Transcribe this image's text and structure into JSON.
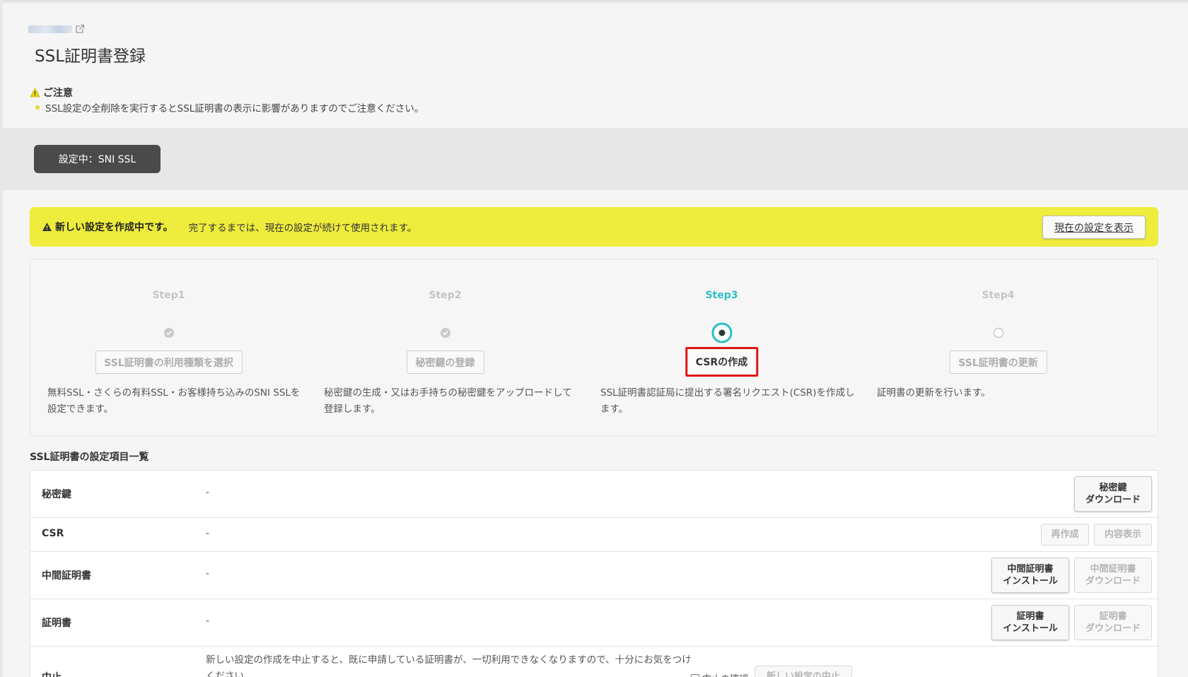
{
  "page": {
    "title": "SSL証明書登録",
    "notice_title": "ご注意",
    "notice_text": "SSL設定の全削除を実行するとSSL証明書の表示に影響がありますのでご注意ください。"
  },
  "status": {
    "current_setting": "設定中：SNI SSL"
  },
  "banner": {
    "warning": "新しい設定を作成中です。",
    "message": "完了するまでは、現在の設定が続けて使用されます。",
    "show_current": "現在の設定を表示"
  },
  "steps": [
    {
      "title": "Step1",
      "button": "SSL証明書の利用種類を選択",
      "desc": "無料SSL・さくらの有料SSL・お客様持ち込みのSNI SSLを設定できます。",
      "state": "done"
    },
    {
      "title": "Step2",
      "button": "秘密鍵の登録",
      "desc": "秘密鍵の生成・又はお手持ちの秘密鍵をアップロードして登録します。",
      "state": "done"
    },
    {
      "title": "Step3",
      "button": "CSRの作成",
      "desc": "SSL証明書認証局に提出する署名リクエスト(CSR)を作成します。",
      "state": "active"
    },
    {
      "title": "Step4",
      "button": "SSL証明書の更新",
      "desc": "証明書の更新を行います。",
      "state": "pending"
    }
  ],
  "settings": {
    "title": "SSL証明書の設定項目一覧",
    "rows": [
      {
        "label": "秘密鍵",
        "value": "-",
        "actions": [
          "秘密鍵\nダウンロード"
        ]
      },
      {
        "label": "CSR",
        "value": "-",
        "actions": [
          "再作成",
          "内容表示"
        ]
      },
      {
        "label": "中間証明書",
        "value": "-",
        "actions": [
          "中間証明書\nインストール",
          "中間証明書\nダウンロード"
        ]
      },
      {
        "label": "証明書",
        "value": "-",
        "actions": [
          "証明書\nインストール",
          "証明書\nダウンロード"
        ]
      },
      {
        "label": "中止",
        "value": "新しい設定の作成を中止すると、既に申請している証明書が、一切利用できなくなりますので、十分にお気をつけください。",
        "check_label": "中止の確認",
        "actions": [
          "新しい設定の中止"
        ]
      }
    ]
  },
  "colors": {
    "accent": "#2bbfc5",
    "banner": "#eeec3c",
    "highlight": "#e01414",
    "dark_button": "#4a4a4a"
  }
}
